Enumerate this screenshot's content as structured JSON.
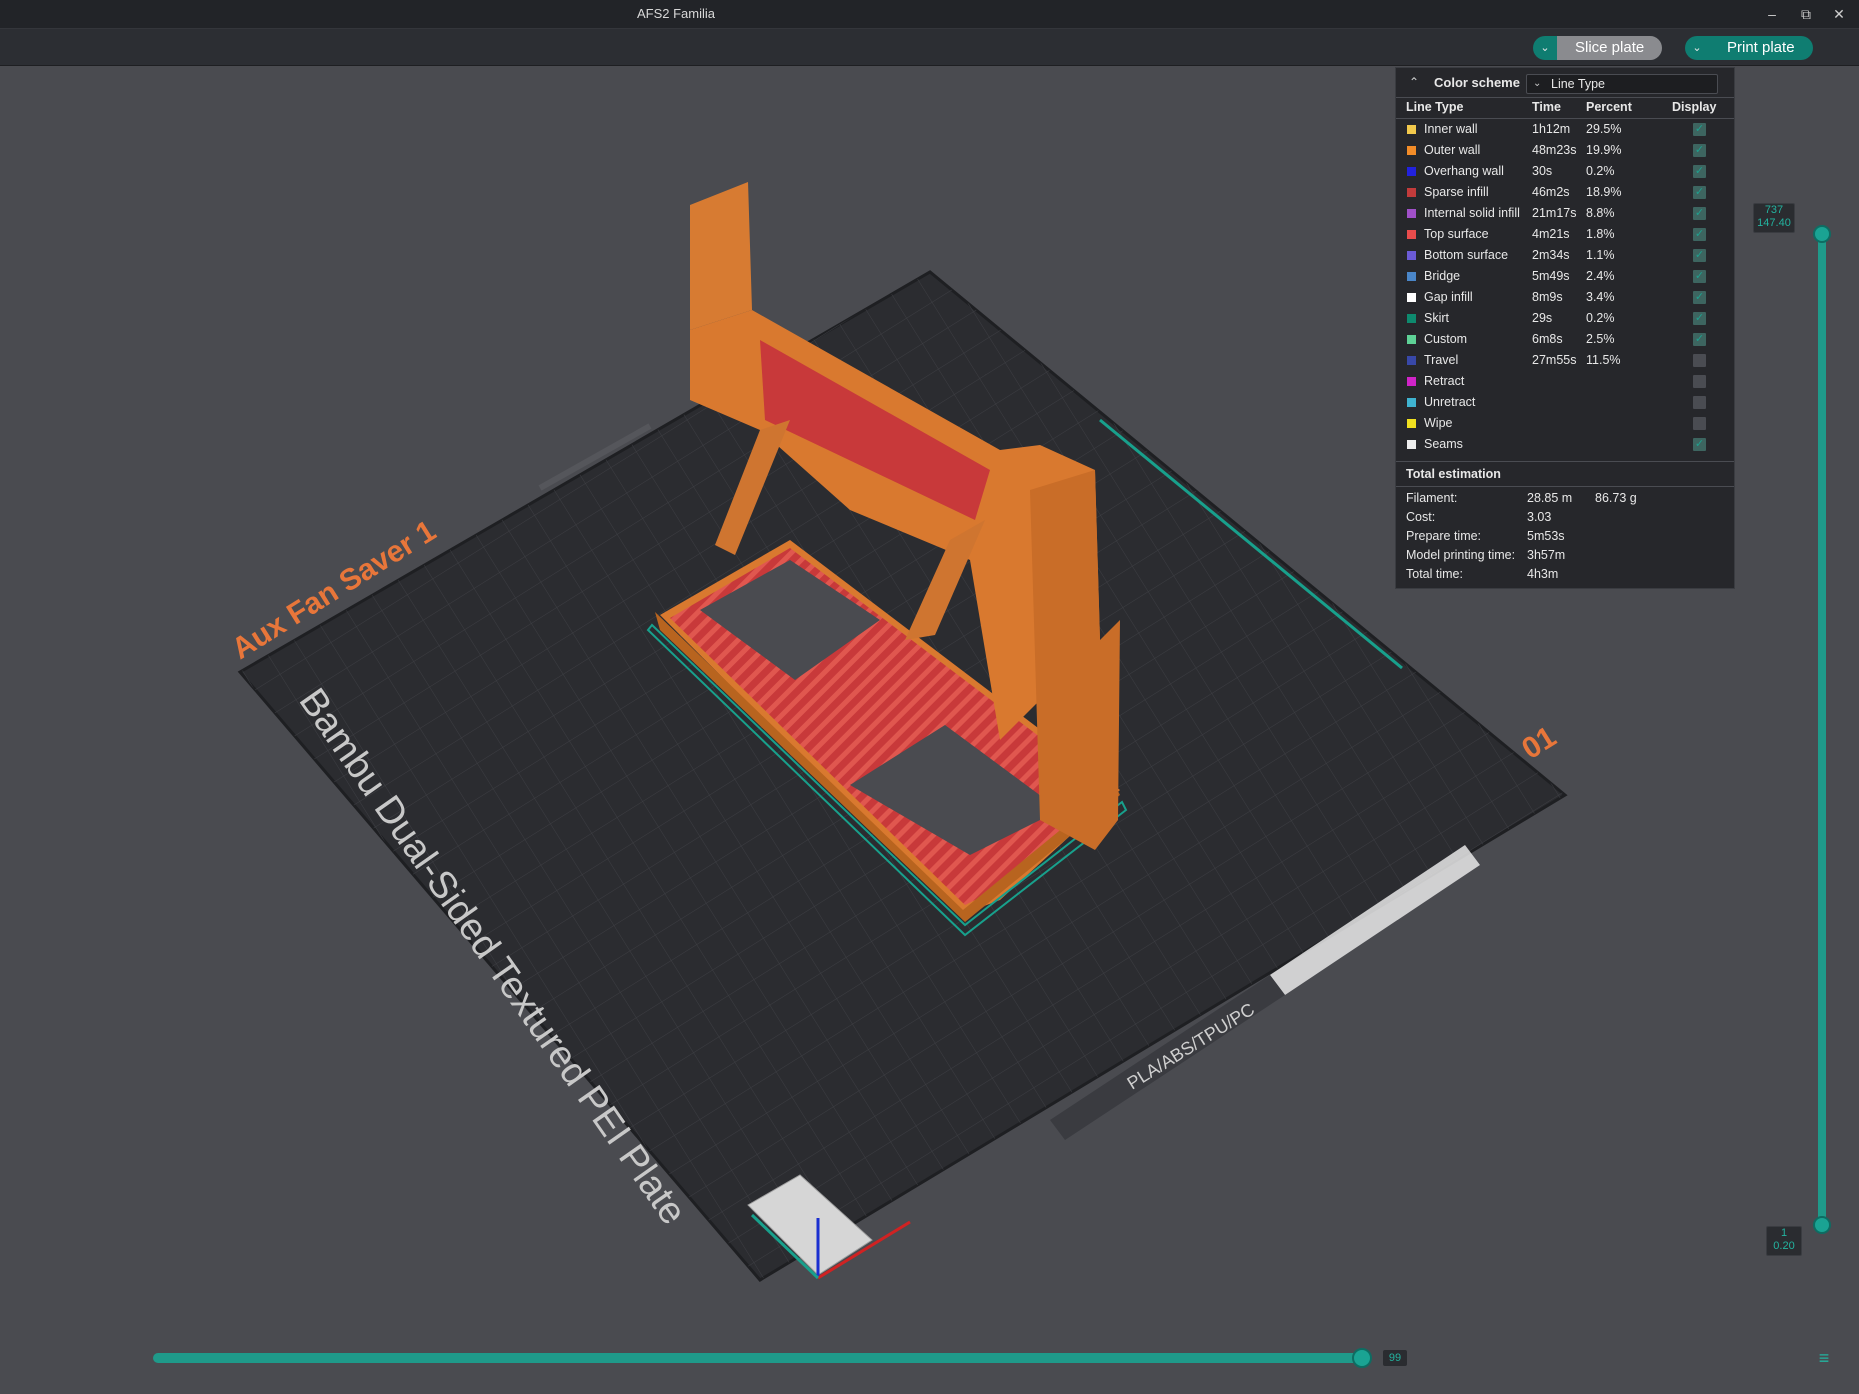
{
  "window": {
    "title": "AFS2 Familia",
    "minimize_icon": "minimize-icon",
    "restore_icon": "restore-icon",
    "close_icon": "close-icon"
  },
  "toolbar": {
    "slice_label": "Slice plate",
    "print_label": "Print plate",
    "dropdown_icon": "chevron-down-icon"
  },
  "legend": {
    "color_scheme_label": "Color scheme",
    "color_scheme_value": "Line Type",
    "headers": {
      "type": "Line Type",
      "time": "Time",
      "percent": "Percent",
      "display": "Display"
    },
    "rows": [
      {
        "name": "Inner wall",
        "time": "1h12m",
        "percent": "29.5%",
        "color": "#f2c94c",
        "display": true
      },
      {
        "name": "Outer wall",
        "time": "48m23s",
        "percent": "19.9%",
        "color": "#f28c28",
        "display": true
      },
      {
        "name": "Overhang wall",
        "time": "30s",
        "percent": "0.2%",
        "color": "#2222dd",
        "display": true
      },
      {
        "name": "Sparse infill",
        "time": "46m2s",
        "percent": "18.9%",
        "color": "#c23b3b",
        "display": true
      },
      {
        "name": "Internal solid infill",
        "time": "21m17s",
        "percent": "8.8%",
        "color": "#a050c8",
        "display": true
      },
      {
        "name": "Top surface",
        "time": "4m21s",
        "percent": "1.8%",
        "color": "#e84c4c",
        "display": true
      },
      {
        "name": "Bottom surface",
        "time": "2m34s",
        "percent": "1.1%",
        "color": "#6b5bd6",
        "display": true
      },
      {
        "name": "Bridge",
        "time": "5m49s",
        "percent": "2.4%",
        "color": "#4a86c8",
        "display": true
      },
      {
        "name": "Gap infill",
        "time": "8m9s",
        "percent": "3.4%",
        "color": "#ffffff",
        "display": true
      },
      {
        "name": "Skirt",
        "time": "29s",
        "percent": "0.2%",
        "color": "#0e8a6e",
        "display": true
      },
      {
        "name": "Custom",
        "time": "6m8s",
        "percent": "2.5%",
        "color": "#5ed196",
        "display": true
      },
      {
        "name": "Travel",
        "time": "27m55s",
        "percent": "11.5%",
        "color": "#3848a8",
        "display": false
      },
      {
        "name": "Retract",
        "time": "",
        "percent": "",
        "color": "#d024c8",
        "display": false
      },
      {
        "name": "Unretract",
        "time": "",
        "percent": "",
        "color": "#3fb3d0",
        "display": false
      },
      {
        "name": "Wipe",
        "time": "",
        "percent": "",
        "color": "#f0e020",
        "display": false
      },
      {
        "name": "Seams",
        "time": "",
        "percent": "",
        "color": "#eeeeee",
        "display": true
      }
    ],
    "total_title": "Total estimation",
    "estimation": [
      {
        "key": "Filament:",
        "v1": "28.85 m",
        "v2": "86.73 g"
      },
      {
        "key": "Cost:",
        "v1": "3.03",
        "v2": ""
      },
      {
        "key": "Prepare time:",
        "v1": "5m53s",
        "v2": ""
      },
      {
        "key": "Model printing time:",
        "v1": "3h57m",
        "v2": ""
      },
      {
        "key": "Total time:",
        "v1": "4h3m",
        "v2": ""
      }
    ]
  },
  "plate": {
    "name": "Aux Fan Saver 1",
    "plate_label": "Bambu Dual-Sided Textured PEI Plate",
    "plate_number": "01",
    "materials": "PLA/ABS/TPU/PC"
  },
  "layer_slider": {
    "top_layer": "737",
    "top_height": "147.40",
    "bottom_layer": "1",
    "bottom_height": "0.20"
  },
  "move_slider": {
    "value": "99",
    "layers_icon": "layers-icon"
  },
  "colors": {
    "accent": "#1f9a8a",
    "model_orange": "#d9792f",
    "infill_red": "#c8393a",
    "bed": "#2b2c30"
  }
}
